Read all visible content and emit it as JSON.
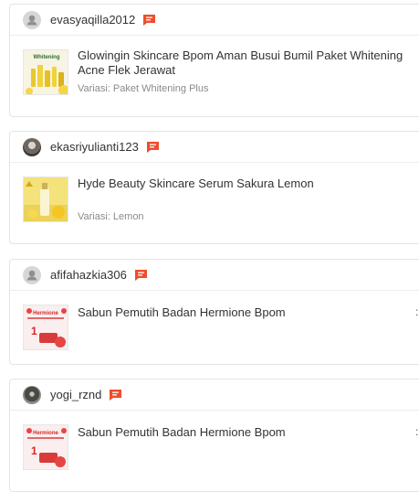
{
  "reviews": [
    {
      "username": "evasyaqilla2012",
      "avatar_icon": "user-avatar-icon",
      "product_name": "Glowingin Skincare Bpom Aman Busui Bumil Paket Whitening Acne Flek Jerawat",
      "variant": "Variasi: Paket Whitening Plus",
      "product_image_text": "Whitening"
    },
    {
      "username": "ekasriyulianti123",
      "avatar_icon": "user-photo-avatar",
      "product_name": "Hyde Beauty Skincare Serum Sakura Lemon",
      "variant": "Variasi: Lemon"
    },
    {
      "username": "afifahazkia306",
      "avatar_icon": "user-avatar-icon",
      "product_name": "Sabun Pemutih Badan Hermione Bpom",
      "product_image_text": "Hermione",
      "side_mark": ":"
    },
    {
      "username": "yogi_rznd",
      "avatar_icon": "user-photo-avatar",
      "product_name": "Sabun Pemutih Badan Hermione Bpom",
      "product_image_text": "Hermione",
      "side_mark": ":"
    }
  ],
  "colors": {
    "chat_icon": "#ee4d2d",
    "border": "#e4e4e4",
    "text": "#333333",
    "muted": "#8a8a8a"
  }
}
